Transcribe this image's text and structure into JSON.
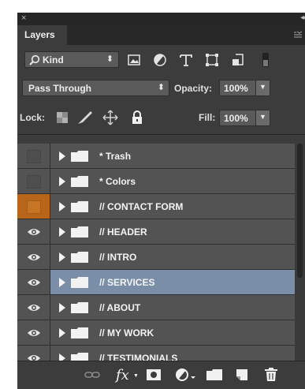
{
  "window": {
    "close_glyph": "×",
    "collapse_glyph": "◂◂"
  },
  "panel": {
    "tab_label": "Layers",
    "menu_icon": "panel-menu-icon"
  },
  "filter": {
    "kind_label": "Kind",
    "filter_icons": [
      "search-icon",
      "pixel-layer-filter-icon",
      "adjustment-layer-filter-icon",
      "type-layer-filter-icon",
      "shape-layer-filter-icon",
      "smart-object-filter-icon",
      "filter-toggle-icon"
    ]
  },
  "blend": {
    "mode": "Pass Through",
    "opacity_label": "Opacity:",
    "opacity_value": "100%"
  },
  "lock": {
    "label": "Lock:",
    "icons": [
      "lock-transparent-icon",
      "lock-image-icon",
      "lock-position-icon",
      "lock-all-icon"
    ],
    "fill_label": "Fill:",
    "fill_value": "100%"
  },
  "layers": [
    {
      "name": "* Trash",
      "visible": false,
      "color": "none",
      "selected": false
    },
    {
      "name": "* Colors",
      "visible": false,
      "color": "none",
      "selected": false
    },
    {
      "name": "// CONTACT FORM",
      "visible": false,
      "color": "orange",
      "selected": false
    },
    {
      "name": "// HEADER",
      "visible": true,
      "color": "none",
      "selected": false
    },
    {
      "name": "// INTRO",
      "visible": true,
      "color": "none",
      "selected": false
    },
    {
      "name": "// SERVICES",
      "visible": true,
      "color": "none",
      "selected": true
    },
    {
      "name": "// ABOUT",
      "visible": true,
      "color": "none",
      "selected": false
    },
    {
      "name": "// MY WORK",
      "visible": true,
      "color": "none",
      "selected": false
    },
    {
      "name": "// TESTIMONIALS",
      "visible": true,
      "color": "none",
      "selected": false
    }
  ],
  "bottom_icons": [
    "link-layers-icon",
    "fx-icon",
    "add-mask-icon",
    "adjustment-layer-icon",
    "new-group-icon",
    "new-layer-icon",
    "delete-icon"
  ],
  "bottom_fx_label": "fx",
  "colors": {
    "panel_bg": "#3c3c3c",
    "row_bg": "#535353",
    "selected_row": "#7a8ea8",
    "label_color_orange": "#b8651a"
  }
}
